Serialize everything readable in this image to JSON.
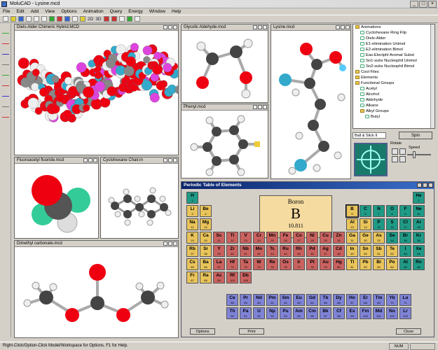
{
  "title": "MoluCAD - Lysine.mcd",
  "window_controls": [
    "_",
    "□",
    "×"
  ],
  "menu": [
    "File",
    "Edit",
    "Add",
    "View",
    "Options",
    "Animation",
    "Query",
    "Energy",
    "Window",
    "Help"
  ],
  "toolbar": {
    "label_2d": "2D",
    "label_3d": "3D"
  },
  "windows": {
    "chimera": "Diels-Alder Chimeric Hybrid.MCD",
    "glycolic": "Glycolic Aldehyde.mcd",
    "lysine": "Lysine.mcd",
    "phenyl": "Phenyl.mcd",
    "fluoroacetyl": "Fluoroacetyl fluoride.mcd",
    "cyclohexane": "Cyclohexane Chair.m",
    "dimethyl": "Dimethyl carbonate.mcd",
    "periodic": "Periodic Table of Elements"
  },
  "tree": [
    {
      "label": "Animations",
      "type": "folder",
      "indent": 0
    },
    {
      "label": "Cyclohexane Ring Flip",
      "type": "leaf",
      "indent": 1
    },
    {
      "label": "Diels-Alder",
      "type": "leaf",
      "indent": 1
    },
    {
      "label": "E1-elimination Unimol",
      "type": "leaf",
      "indent": 1
    },
    {
      "label": "E2-elimination Bimol",
      "type": "leaf",
      "indent": 1
    },
    {
      "label": "Eas-Electphl Aromat Subst",
      "type": "leaf",
      "indent": 1
    },
    {
      "label": "Sn1-subs Nucleophil Unimol",
      "type": "leaf",
      "indent": 1
    },
    {
      "label": "Sn2-subs Nucleophil Bimol",
      "type": "leaf",
      "indent": 1
    },
    {
      "label": "Cool Files",
      "type": "folder",
      "indent": 0
    },
    {
      "label": "Elements",
      "type": "folder",
      "indent": 0
    },
    {
      "label": "Functional Groups",
      "type": "folder",
      "indent": 0
    },
    {
      "label": "Acetyl",
      "type": "leaf",
      "indent": 1
    },
    {
      "label": "Alcohol",
      "type": "leaf",
      "indent": 1
    },
    {
      "label": "Aldehyde",
      "type": "leaf",
      "indent": 1
    },
    {
      "label": "Alkane",
      "type": "leaf",
      "indent": 1
    },
    {
      "label": "Alkyl Groups",
      "type": "folder",
      "indent": 1
    },
    {
      "label": "Butyl",
      "type": "leaf",
      "indent": 2
    }
  ],
  "controls": {
    "render_mode": "Ball & Stick II",
    "spin_label": "Spin",
    "rotate_label": "Rotate",
    "speed_label": "Speed",
    "speed_level": 0.25
  },
  "periodic": {
    "selected": {
      "name": "Boron",
      "symbol": "B",
      "mass": "10.811"
    },
    "buttons": {
      "options": "Options",
      "print": "Print",
      "close": "Close"
    },
    "colors": {
      "alkali": "#e9c45a",
      "alkaline": "#e9c45a",
      "transition": "#c9625f",
      "metalloid": "#e9c45a",
      "nonmetal": "#1f9a86",
      "lanthanide": "#7f83d6",
      "poor": "#e9c45a",
      "noble": "#1f9a86"
    },
    "elements": [
      [
        "H",
        1,
        1,
        1,
        "nonmetal"
      ],
      [
        "He",
        2,
        18,
        1,
        "noble"
      ],
      [
        "Li",
        3,
        1,
        2,
        "alkali"
      ],
      [
        "Be",
        4,
        2,
        2,
        "alkaline"
      ],
      [
        "B",
        5,
        13,
        2,
        "metalloid"
      ],
      [
        "C",
        6,
        14,
        2,
        "nonmetal"
      ],
      [
        "N",
        7,
        15,
        2,
        "nonmetal"
      ],
      [
        "O",
        8,
        16,
        2,
        "nonmetal"
      ],
      [
        "F",
        9,
        17,
        2,
        "nonmetal"
      ],
      [
        "Ne",
        10,
        18,
        2,
        "noble"
      ],
      [
        "Na",
        11,
        1,
        3,
        "alkali"
      ],
      [
        "Mg",
        12,
        2,
        3,
        "alkaline"
      ],
      [
        "Al",
        13,
        13,
        3,
        "poor"
      ],
      [
        "Si",
        14,
        14,
        3,
        "metalloid"
      ],
      [
        "P",
        15,
        15,
        3,
        "nonmetal"
      ],
      [
        "S",
        16,
        16,
        3,
        "nonmetal"
      ],
      [
        "Cl",
        17,
        17,
        3,
        "nonmetal"
      ],
      [
        "Ar",
        18,
        18,
        3,
        "noble"
      ],
      [
        "K",
        19,
        1,
        4,
        "alkali"
      ],
      [
        "Ca",
        20,
        2,
        4,
        "alkaline"
      ],
      [
        "Sc",
        21,
        3,
        4,
        "transition"
      ],
      [
        "Ti",
        22,
        4,
        4,
        "transition"
      ],
      [
        "V",
        23,
        5,
        4,
        "transition"
      ],
      [
        "Cr",
        24,
        6,
        4,
        "transition"
      ],
      [
        "Mn",
        25,
        7,
        4,
        "transition"
      ],
      [
        "Fe",
        26,
        8,
        4,
        "transition"
      ],
      [
        "Co",
        27,
        9,
        4,
        "transition"
      ],
      [
        "Ni",
        28,
        10,
        4,
        "transition"
      ],
      [
        "Cu",
        29,
        11,
        4,
        "transition"
      ],
      [
        "Zn",
        30,
        12,
        4,
        "transition"
      ],
      [
        "Ga",
        31,
        13,
        4,
        "poor"
      ],
      [
        "Ge",
        32,
        14,
        4,
        "metalloid"
      ],
      [
        "As",
        33,
        15,
        4,
        "metalloid"
      ],
      [
        "Se",
        34,
        16,
        4,
        "nonmetal"
      ],
      [
        "Br",
        35,
        17,
        4,
        "nonmetal"
      ],
      [
        "Kr",
        36,
        18,
        4,
        "noble"
      ],
      [
        "Rb",
        37,
        1,
        5,
        "alkali"
      ],
      [
        "Sr",
        38,
        2,
        5,
        "alkaline"
      ],
      [
        "Y",
        39,
        3,
        5,
        "transition"
      ],
      [
        "Zr",
        40,
        4,
        5,
        "transition"
      ],
      [
        "Nb",
        41,
        5,
        5,
        "transition"
      ],
      [
        "Mo",
        42,
        6,
        5,
        "transition"
      ],
      [
        "Tc",
        43,
        7,
        5,
        "transition"
      ],
      [
        "Ru",
        44,
        8,
        5,
        "transition"
      ],
      [
        "Rh",
        45,
        9,
        5,
        "transition"
      ],
      [
        "Pd",
        46,
        10,
        5,
        "transition"
      ],
      [
        "Ag",
        47,
        11,
        5,
        "transition"
      ],
      [
        "Cd",
        48,
        12,
        5,
        "transition"
      ],
      [
        "In",
        49,
        13,
        5,
        "poor"
      ],
      [
        "Sn",
        50,
        14,
        5,
        "poor"
      ],
      [
        "Sb",
        51,
        15,
        5,
        "metalloid"
      ],
      [
        "Te",
        52,
        16,
        5,
        "metalloid"
      ],
      [
        "I",
        53,
        17,
        5,
        "nonmetal"
      ],
      [
        "Xe",
        54,
        18,
        5,
        "noble"
      ],
      [
        "Cs",
        55,
        1,
        6,
        "alkali"
      ],
      [
        "Ba",
        56,
        2,
        6,
        "alkaline"
      ],
      [
        "La",
        57,
        3,
        6,
        "transition"
      ],
      [
        "Hf",
        72,
        4,
        6,
        "transition"
      ],
      [
        "Ta",
        73,
        5,
        6,
        "transition"
      ],
      [
        "W",
        74,
        6,
        6,
        "transition"
      ],
      [
        "Re",
        75,
        7,
        6,
        "transition"
      ],
      [
        "Os",
        76,
        8,
        6,
        "transition"
      ],
      [
        "Ir",
        77,
        9,
        6,
        "transition"
      ],
      [
        "Pt",
        78,
        10,
        6,
        "transition"
      ],
      [
        "Au",
        79,
        11,
        6,
        "transition"
      ],
      [
        "Hg",
        80,
        12,
        6,
        "transition"
      ],
      [
        "Tl",
        81,
        13,
        6,
        "poor"
      ],
      [
        "Pb",
        82,
        14,
        6,
        "poor"
      ],
      [
        "Bi",
        83,
        15,
        6,
        "poor"
      ],
      [
        "Po",
        84,
        16,
        6,
        "metalloid"
      ],
      [
        "At",
        85,
        17,
        6,
        "nonmetal"
      ],
      [
        "Rn",
        86,
        18,
        6,
        "noble"
      ],
      [
        "Fr",
        87,
        1,
        7,
        "alkali"
      ],
      [
        "Ra",
        88,
        2,
        7,
        "alkaline"
      ],
      [
        "Ac",
        89,
        3,
        7,
        "transition"
      ],
      [
        "Rf",
        104,
        4,
        7,
        "transition"
      ],
      [
        "Db",
        105,
        5,
        7,
        "transition"
      ],
      [
        "Ce",
        58,
        4,
        9,
        "lanthanide"
      ],
      [
        "Pr",
        59,
        5,
        9,
        "lanthanide"
      ],
      [
        "Nd",
        60,
        6,
        9,
        "lanthanide"
      ],
      [
        "Pm",
        61,
        7,
        9,
        "lanthanide"
      ],
      [
        "Sm",
        62,
        8,
        9,
        "lanthanide"
      ],
      [
        "Eu",
        63,
        9,
        9,
        "lanthanide"
      ],
      [
        "Gd",
        64,
        10,
        9,
        "lanthanide"
      ],
      [
        "Tb",
        65,
        11,
        9,
        "lanthanide"
      ],
      [
        "Dy",
        66,
        12,
        9,
        "lanthanide"
      ],
      [
        "Ho",
        67,
        13,
        9,
        "lanthanide"
      ],
      [
        "Er",
        68,
        14,
        9,
        "lanthanide"
      ],
      [
        "Tm",
        69,
        15,
        9,
        "lanthanide"
      ],
      [
        "Yb",
        70,
        16,
        9,
        "lanthanide"
      ],
      [
        "Lu",
        71,
        17,
        9,
        "lanthanide"
      ],
      [
        "Th",
        90,
        4,
        10,
        "lanthanide"
      ],
      [
        "Pa",
        91,
        5,
        10,
        "lanthanide"
      ],
      [
        "U",
        92,
        6,
        10,
        "lanthanide"
      ],
      [
        "Np",
        93,
        7,
        10,
        "lanthanide"
      ],
      [
        "Pu",
        94,
        8,
        10,
        "lanthanide"
      ],
      [
        "Am",
        95,
        9,
        10,
        "lanthanide"
      ],
      [
        "Cm",
        96,
        10,
        10,
        "lanthanide"
      ],
      [
        "Bk",
        97,
        11,
        10,
        "lanthanide"
      ],
      [
        "Cf",
        98,
        12,
        10,
        "lanthanide"
      ],
      [
        "Es",
        99,
        13,
        10,
        "lanthanide"
      ],
      [
        "Fm",
        100,
        14,
        10,
        "lanthanide"
      ],
      [
        "Md",
        101,
        15,
        10,
        "lanthanide"
      ],
      [
        "No",
        102,
        16,
        10,
        "lanthanide"
      ],
      [
        "Lr",
        103,
        17,
        10,
        "lanthanide"
      ]
    ]
  },
  "status": {
    "hint": "Right-Click/Option-Click Model/Workspace for Options. F1 for Help.",
    "num": "NUM"
  }
}
